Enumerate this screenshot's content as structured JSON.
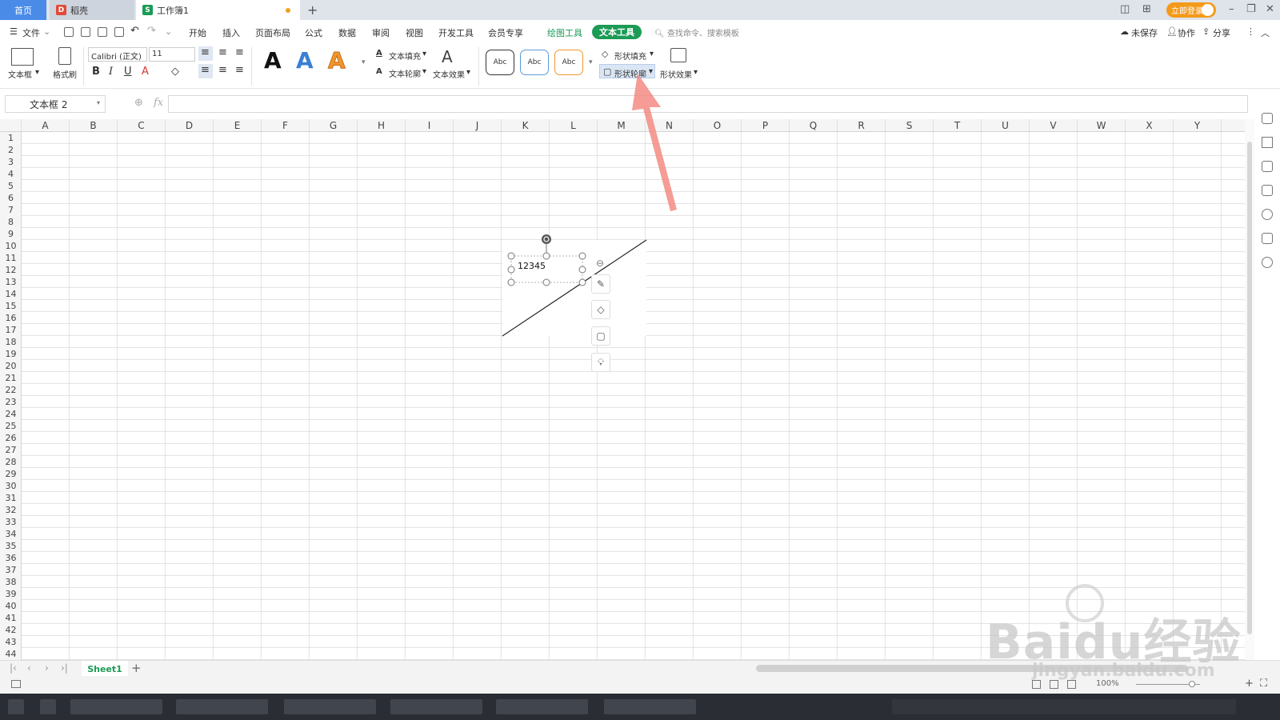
{
  "titlebar": {
    "tabs": [
      {
        "label": "首页"
      },
      {
        "label": "稻壳"
      },
      {
        "label": "工作簿1"
      }
    ],
    "new_tab": "+",
    "login_button": "立即登录"
  },
  "menubar": {
    "file_menu": "文件",
    "items": [
      "开始",
      "插入",
      "页面布局",
      "公式",
      "数据",
      "审阅",
      "视图",
      "开发工具",
      "会员专享"
    ],
    "drawing_tools": "绘图工具",
    "text_tools": "文本工具",
    "search_placeholder": "查找命令、搜索模板",
    "unsaved": "未保存",
    "collaborate": "协作",
    "share": "分享"
  },
  "ribbon": {
    "textbox_label": "文本框",
    "format_painter_label": "格式刷",
    "font_name": "Calibri (正文)",
    "font_size": "11",
    "text_fill": "文本填充",
    "text_outline": "文本轮廓",
    "text_effect": "文本效果",
    "shape_styles": [
      "Abc",
      "Abc",
      "Abc"
    ],
    "shape_fill": "形状填充",
    "shape_outline": "形状轮廓",
    "shape_effect": "形状效果",
    "style_letters": [
      "A",
      "A",
      "A"
    ],
    "style_colors": [
      "#111111",
      "#3a7fd5",
      "#f0962e"
    ]
  },
  "formulabar": {
    "name_box": "文本框 2",
    "fx": "fx",
    "formula_value": ""
  },
  "grid": {
    "columns": [
      "A",
      "B",
      "C",
      "D",
      "E",
      "F",
      "G",
      "H",
      "I",
      "J",
      "K",
      "L",
      "M",
      "N",
      "O",
      "P",
      "Q",
      "R",
      "S",
      "T",
      "U",
      "V",
      "W",
      "X",
      "Y"
    ],
    "row_count": 44
  },
  "shape": {
    "textbox_text": "12345"
  },
  "sheetbar": {
    "sheet_name": "Sheet1",
    "add_sheet": "+"
  },
  "statusbar": {
    "zoom": "100%"
  },
  "watermark": {
    "brand": "Baidu经验",
    "url": "jingyan.baidu.com"
  },
  "colors": {
    "accent_green": "#1b9b55",
    "tab_blue": "#4a8be8",
    "login_orange": "#f39a1a",
    "annotation_arrow": "#f28b82"
  }
}
